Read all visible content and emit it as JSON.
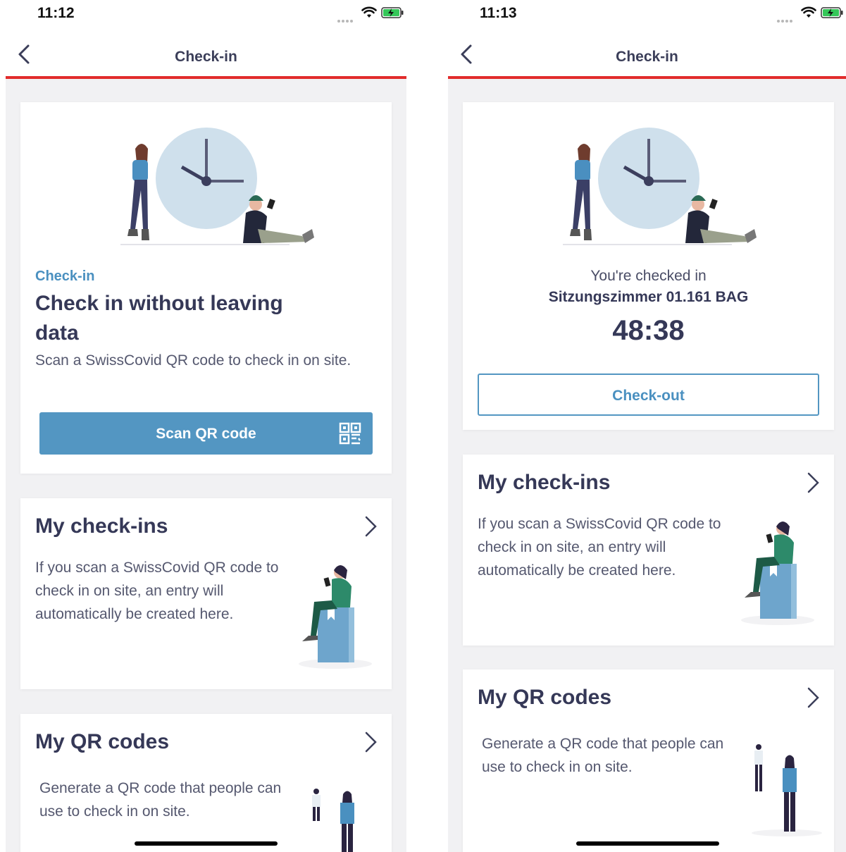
{
  "left": {
    "status_time": "11:12",
    "nav_title": "Check-in",
    "checkin_card": {
      "eyebrow": "Check-in",
      "title": "Check in without leaving data",
      "description": "Scan a SwissCovid QR code to check in on site.",
      "button_label": "Scan QR code"
    },
    "my_checkins": {
      "title": "My check-ins",
      "description": "If you scan a SwissCovid QR code to check in on site, an entry will automatically be created here."
    },
    "my_qr_codes": {
      "title": "My QR codes",
      "description": "Generate a QR code that people can use to check in on site."
    }
  },
  "right": {
    "status_time": "11:13",
    "nav_title": "Check-in",
    "checked_in_card": {
      "status_text": "You're checked in",
      "location": "Sitzungszimmer 01.161 BAG",
      "timer": "48:38",
      "button_label": "Check-out"
    },
    "my_checkins": {
      "title": "My check-ins",
      "description": "If you scan a SwissCovid QR code to check in on site, an entry will automatically be created here."
    },
    "my_qr_codes": {
      "title": "My QR codes",
      "description": "Generate a QR code that people can use to check in on site."
    }
  },
  "icons": {
    "back": "chevron-left-icon",
    "forward": "chevron-right-icon",
    "qr": "qr-code-icon",
    "wifi": "wifi-icon",
    "battery": "battery-charging-icon"
  },
  "colors": {
    "accent": "#5396c2",
    "nav_divider": "#e22b2b",
    "heading": "#353857",
    "background": "#f1f1f3"
  }
}
